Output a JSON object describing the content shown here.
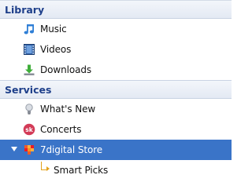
{
  "library": {
    "title": "Library",
    "items": [
      {
        "label": "Music",
        "icon": "music-note-icon"
      },
      {
        "label": "Videos",
        "icon": "film-strip-icon"
      },
      {
        "label": "Downloads",
        "icon": "download-arrow-icon"
      }
    ]
  },
  "services": {
    "title": "Services",
    "items": [
      {
        "label": "What's New",
        "icon": "lightbulb-icon"
      },
      {
        "label": "Concerts",
        "icon": "songkick-sk-icon"
      },
      {
        "label": "7digital Store",
        "icon": "7digital-store-icon",
        "selected": true,
        "expanded": true
      },
      {
        "label": "Smart Picks",
        "icon": "sub-branch-arrow-icon"
      }
    ]
  },
  "colors": {
    "header_text": "#1e3f8a",
    "selection": "#3a74c8",
    "branch": "#e3a21a"
  }
}
